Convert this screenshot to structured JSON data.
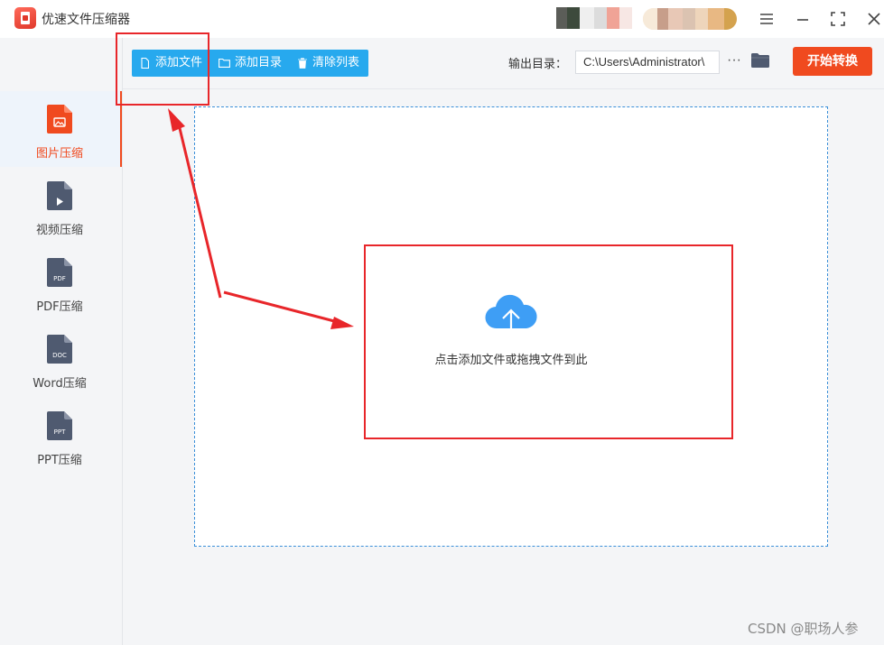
{
  "app": {
    "title": "优速文件压缩器"
  },
  "toolbar": {
    "add_file": "添加文件",
    "add_folder": "添加目录",
    "clear_list": "清除列表",
    "output_label": "输出目录：",
    "output_path": "C:\\Users\\Administrator\\",
    "more_label": "···",
    "start_label": "开始转换"
  },
  "sidebar": {
    "items": [
      {
        "label": "图片压缩",
        "icon": "image-file-icon",
        "tag": "",
        "active": true
      },
      {
        "label": "视频压缩",
        "icon": "video-file-icon",
        "tag": "",
        "active": false
      },
      {
        "label": "PDF压缩",
        "icon": "pdf-file-icon",
        "tag": "PDF",
        "active": false
      },
      {
        "label": "Word压缩",
        "icon": "word-file-icon",
        "tag": "DOC",
        "active": false
      },
      {
        "label": "PPT压缩",
        "icon": "ppt-file-icon",
        "tag": "PPT",
        "active": false
      }
    ]
  },
  "dropzone": {
    "text": "点击添加文件或拖拽文件到此"
  },
  "colors": {
    "accent_blue": "#27a9ee",
    "start_orange": "#f04a1f",
    "annotation_red": "#e8262a",
    "icon_dark": "#4f5a70"
  },
  "watermark": "CSDN @职场人参"
}
